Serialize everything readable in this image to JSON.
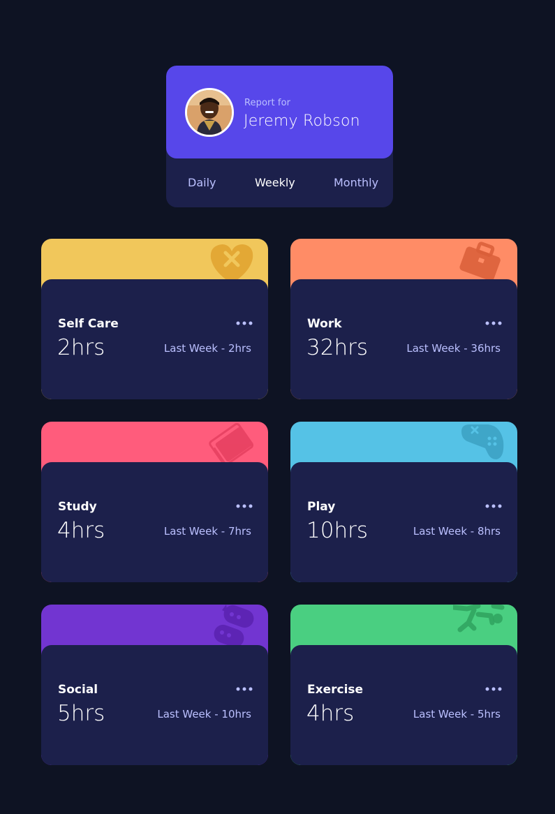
{
  "profile": {
    "report_for": "Report for",
    "name": "Jeremy Robson",
    "avatar_icon": "person-avatar"
  },
  "tabs": [
    {
      "label": "Daily",
      "active": false
    },
    {
      "label": "Weekly",
      "active": true
    },
    {
      "label": "Monthly",
      "active": false
    }
  ],
  "cards": [
    {
      "title": "Self Care",
      "hours": "2hrs",
      "previous": "Last Week - 2hrs",
      "color": "#f1c75b",
      "icon": "heart-self-care-icon"
    },
    {
      "title": "Work",
      "hours": "32hrs",
      "previous": "Last Week - 36hrs",
      "color": "#ff8c66",
      "icon": "briefcase-icon"
    },
    {
      "title": "Study",
      "hours": "4hrs",
      "previous": "Last Week - 7hrs",
      "color": "#ff5c7c",
      "icon": "book-icon"
    },
    {
      "title": "Play",
      "hours": "10hrs",
      "previous": "Last Week - 8hrs",
      "color": "#55c2e6",
      "icon": "gamepad-icon"
    },
    {
      "title": "Social",
      "hours": "5hrs",
      "previous": "Last Week - 10hrs",
      "color": "#7235d1",
      "icon": "chat-bubbles-icon"
    },
    {
      "title": "Exercise",
      "hours": "4hrs",
      "previous": "Last Week - 5hrs",
      "color": "#4acf81",
      "icon": "running-person-icon"
    }
  ],
  "colors": {
    "background": "#0e1323",
    "card": "#1c204b",
    "accent": "#5747ea",
    "muted_text": "#bbc0ff"
  }
}
